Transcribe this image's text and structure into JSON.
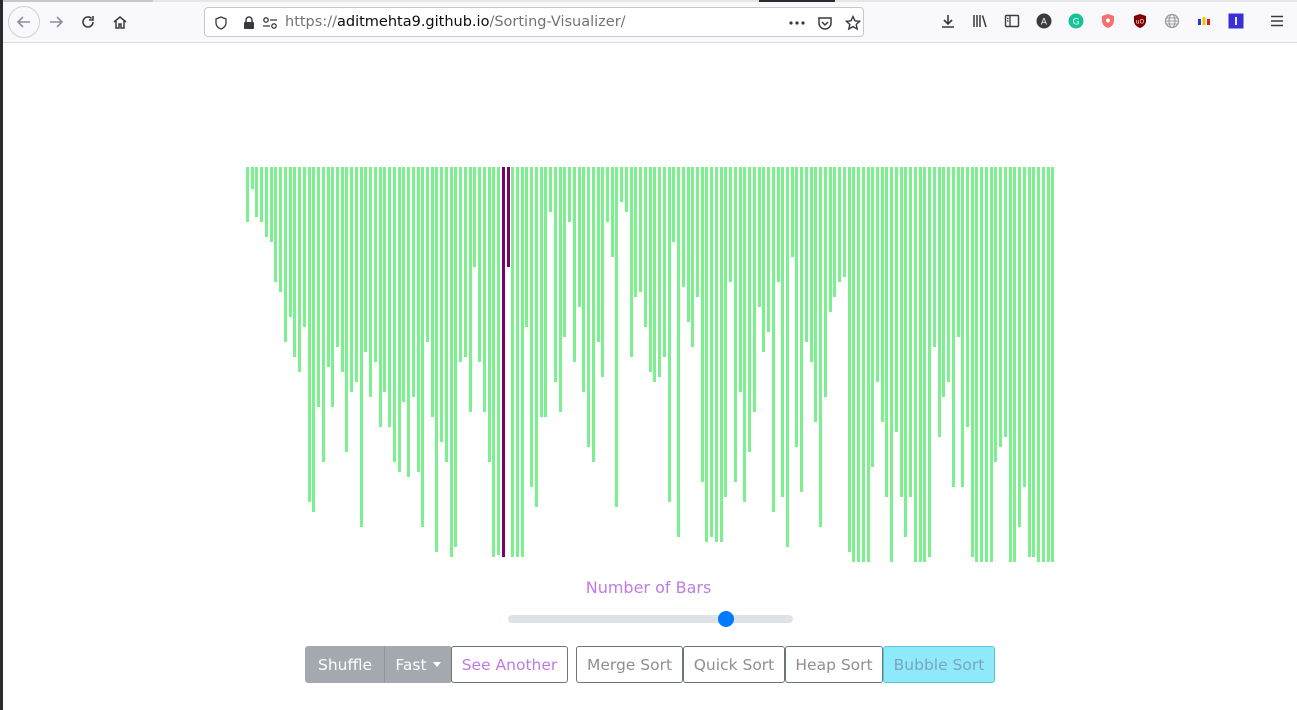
{
  "browser": {
    "url_prefix": "https://",
    "url_host": "aditmehta9.github.io",
    "url_path": "/Sorting-Visualizer/"
  },
  "visualizer": {
    "slider_label": "Number of Bars",
    "slider_value_fraction": 0.765,
    "colors": {
      "bar": "#7cf08e",
      "active": "#7a006e"
    },
    "bar_heights": [
      55,
      22,
      50,
      55,
      70,
      75,
      115,
      125,
      175,
      150,
      190,
      205,
      160,
      335,
      345,
      240,
      295,
      200,
      240,
      180,
      205,
      285,
      225,
      215,
      360,
      185,
      230,
      195,
      260,
      225,
      260,
      295,
      305,
      235,
      310,
      230,
      305,
      360,
      175,
      250,
      385,
      275,
      295,
      390,
      380,
      195,
      190,
      245,
      100,
      195,
      245,
      295,
      390,
      388,
      390,
      100,
      390,
      390,
      390,
      160,
      320,
      340,
      250,
      250,
      45,
      215,
      245,
      170,
      55,
      195,
      140,
      225,
      280,
      295,
      175,
      210,
      55,
      90,
      340,
      35,
      45,
      190,
      130,
      125,
      160,
      205,
      215,
      210,
      190,
      335,
      75,
      370,
      120,
      155,
      180,
      130,
      315,
      375,
      370,
      375,
      375,
      330,
      115,
      315,
      225,
      335,
      285,
      245,
      140,
      185,
      165,
      345,
      115,
      330,
      380,
      90,
      280,
      325,
      175,
      195,
      255,
      360,
      230,
      145,
      130,
      115,
      110,
      385,
      395,
      395,
      395,
      395,
      300,
      215,
      255,
      330,
      395,
      265,
      330,
      370,
      330,
      395,
      395,
      395,
      390,
      180,
      270,
      230,
      215,
      320,
      170,
      320,
      260,
      390,
      395,
      395,
      395,
      395,
      295,
      280,
      270,
      395,
      395,
      360,
      320,
      390,
      390,
      395,
      395,
      395,
      395
    ],
    "active_bars": [
      54,
      55
    ]
  },
  "controls": {
    "shuffle": "Shuffle",
    "speed": "Fast",
    "see_another": "See Another",
    "merge_sort": "Merge Sort",
    "quick_sort": "Quick Sort",
    "heap_sort": "Heap Sort",
    "bubble_sort": "Bubble Sort"
  }
}
